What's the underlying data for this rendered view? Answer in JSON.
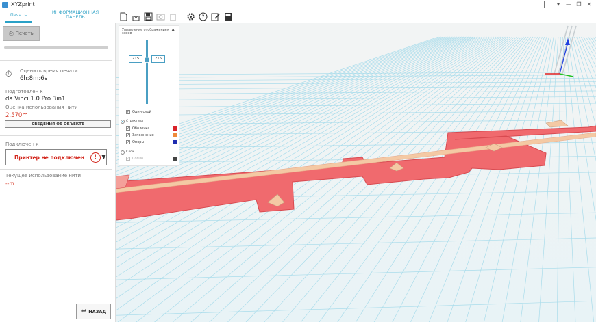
{
  "window": {
    "title": "XYZprint"
  },
  "tabs": [
    {
      "label": "Печать",
      "active": true
    },
    {
      "label": "ИНФОРМАЦИОННАЯ ПАНЕЛЬ",
      "active": false
    }
  ],
  "toolbar": {
    "icons": [
      "new-file-icon",
      "import-icon",
      "save-icon",
      "screenshot-icon",
      "delete-icon",
      "settings-icon",
      "help-icon",
      "edit-icon",
      "calculator-icon"
    ]
  },
  "left": {
    "print_button": "Печать",
    "print_progress": 0,
    "time_label": "Оценить время печати",
    "time_value": "6h:8m:6s",
    "prepared_label": "Подготовлен к",
    "printer_model": "da Vinci 1.0 Pro 3in1",
    "filament_label": "Оценка использования нити",
    "filament_value": "2.570m",
    "object_info_button": "СВЕДЕНИЯ ОБ ОБЪЕКТЕ",
    "connected_label": "Подключен к",
    "printer_status": "Принтер не подключен",
    "current_filament_label": "Текущее использование нити",
    "current_filament_value": "--m",
    "back_button": "НАЗАД"
  },
  "layer_panel": {
    "title": "Управление отображением слоев",
    "layer_from": "215",
    "layer_to": "215",
    "single_layer_label": "Один слой",
    "single_layer_checked": true,
    "structure_label": "Структура",
    "items": [
      {
        "label": "Оболочка",
        "checked": true,
        "color": "#d9232a"
      },
      {
        "label": "Заполнение",
        "checked": true,
        "color": "#ee8a3a"
      },
      {
        "label": "Опоры",
        "checked": true,
        "color": "#1f2db0"
      }
    ],
    "layers_label": "Слои",
    "layers_sub_label": "Сопло",
    "layers_sub_color": "#444444"
  },
  "colors": {
    "accent": "#2aa1c7",
    "error": "#d3281e",
    "shell": "#f06a6e",
    "infill": "#f4c9a4",
    "grid": "#a9dceb",
    "axis_x": "#e02020",
    "axis_y": "#20c020",
    "axis_z": "#2040e0"
  }
}
